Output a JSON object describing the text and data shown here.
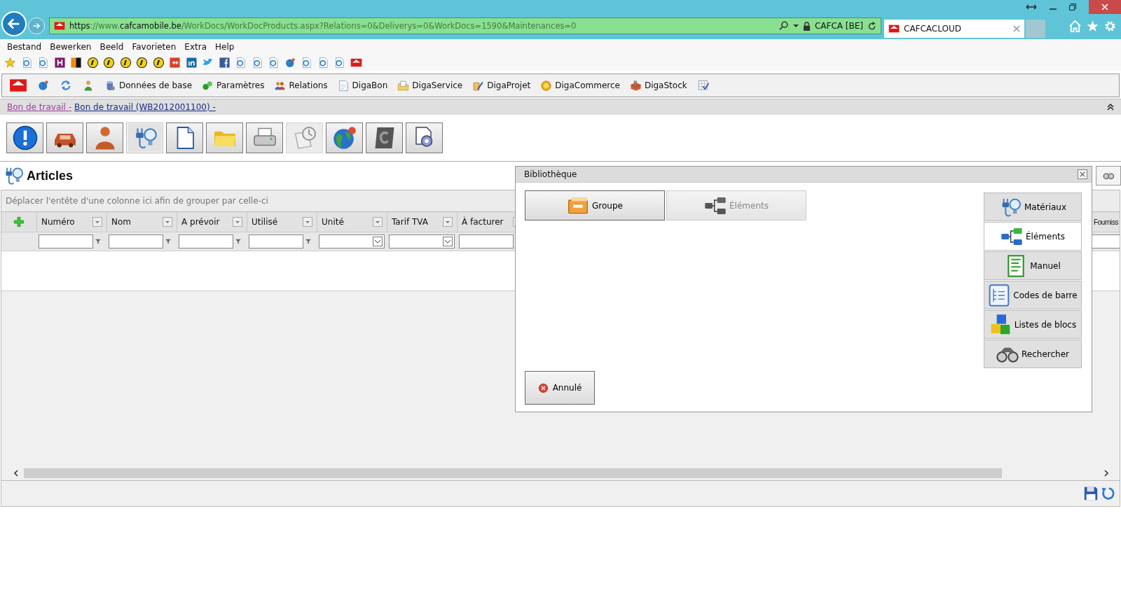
{
  "browser": {
    "url_parts": [
      {
        "text": "https",
        "strong": true
      },
      {
        "text": "://www.",
        "strong": false
      },
      {
        "text": "cafcamobile.be",
        "strong": true
      },
      {
        "text": "/WorkDocs/WorkDocProducts.aspx?Relations=0&Deliverys=0&WorkDocs=1590&Maintenances=0",
        "strong": false
      }
    ],
    "site": "CAFCA [BE]",
    "tabs": [
      {
        "label": "CAFCACLOUD",
        "selected": true
      }
    ]
  },
  "menu": [
    "Bestand",
    "Bewerken",
    "Beeld",
    "Favorieten",
    "Extra",
    "Help"
  ],
  "app_toolbar": [
    {
      "label": "Données de base"
    },
    {
      "label": "Paramètres"
    },
    {
      "label": "Relations"
    },
    {
      "label": "DigaBon"
    },
    {
      "label": "DigaService"
    },
    {
      "label": "DigaProjet"
    },
    {
      "label": "DigaCommerce"
    },
    {
      "label": "DigaStock"
    }
  ],
  "breadcrumb": [
    {
      "text": "Bon de travail -",
      "visited": true
    },
    {
      "text": "Bon de travail (WB2012001100) -",
      "visited": false
    }
  ],
  "actions": [
    {
      "kind": "info",
      "selected": false,
      "disabled": false
    },
    {
      "kind": "car",
      "selected": false,
      "disabled": false
    },
    {
      "kind": "person",
      "selected": false,
      "disabled": false
    },
    {
      "kind": "plug",
      "selected": true,
      "disabled": false
    },
    {
      "kind": "page",
      "selected": false,
      "disabled": false
    },
    {
      "kind": "folder",
      "selected": false,
      "disabled": false
    },
    {
      "kind": "printer",
      "selected": false,
      "disabled": false
    },
    {
      "kind": "clock",
      "selected": false,
      "disabled": true
    },
    {
      "kind": "globe",
      "selected": false,
      "disabled": false
    },
    {
      "kind": "tile",
      "selected": false,
      "disabled": false
    },
    {
      "kind": "gear",
      "selected": false,
      "disabled": false
    }
  ],
  "page_title": "Articles",
  "grid": {
    "group_hint": "Déplacer l'entête d'une colonne ici afin de grouper par celle-ci",
    "columns": [
      {
        "label": "Numéro",
        "kind": "text"
      },
      {
        "label": "Nom",
        "kind": "text"
      },
      {
        "label": "A prévoir",
        "kind": "text"
      },
      {
        "label": "Utilisé",
        "kind": "text"
      },
      {
        "label": "Unité",
        "kind": "select"
      },
      {
        "label": "Tarif TVA",
        "kind": "select"
      },
      {
        "label": "À facturer",
        "kind": "text"
      }
    ],
    "last_column": {
      "label": "Fourniss"
    }
  },
  "dialog": {
    "title": "Bibliothèque",
    "modes": [
      {
        "label": "Groupe",
        "disabled": false
      },
      {
        "label": "Éléments",
        "disabled": true
      }
    ],
    "sources": [
      {
        "label": "Matériaux",
        "selected": false
      },
      {
        "label": "Éléments",
        "selected": true
      },
      {
        "label": "Manuel",
        "selected": false
      },
      {
        "label": "Codes de barre",
        "selected": false
      },
      {
        "label": "Listes de blocs",
        "selected": false
      },
      {
        "label": "Rechercher",
        "selected": false
      }
    ],
    "cancel": "Annulé"
  }
}
